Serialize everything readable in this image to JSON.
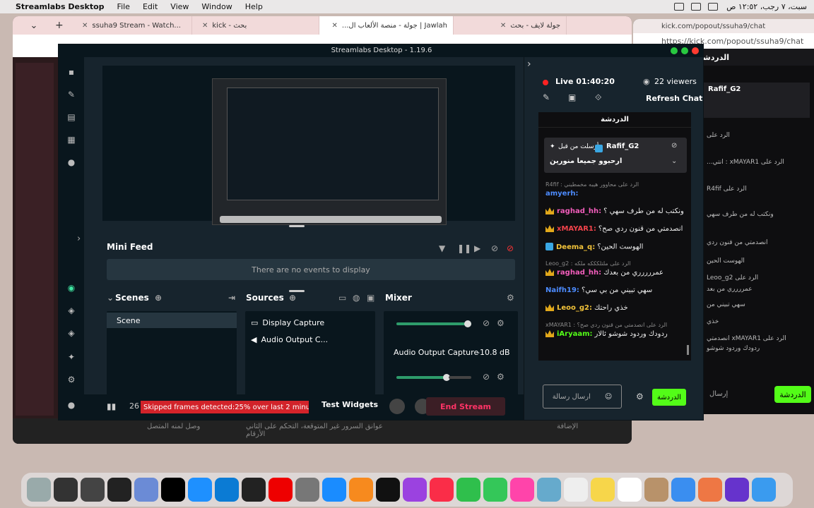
{
  "menubar": {
    "app_name": "Streamlabs Desktop",
    "items": [
      "File",
      "Edit",
      "View",
      "Window",
      "Help"
    ],
    "clock": "سبت، ٧ رجب، ١٢:٥٢ ص"
  },
  "browser": {
    "tabs": [
      {
        "label": "جولة لايف - بحث",
        "active": false
      },
      {
        "label": "Jawlah | جولة - منصة الألعاب ال...",
        "active": true
      },
      {
        "label": "kick - بحث",
        "active": false
      },
      {
        "label": "ssuha9 Stream - Watch...",
        "active": false
      }
    ],
    "bottom_texts": [
      "وصل لمنه المتصل",
      "عوانق السرور غير المتوقعة، التحكم على الثاني الأرقام",
      "الإضافة"
    ]
  },
  "popout": {
    "tab_label": "kick.com/popout/ssuha9/chat",
    "url": "https://kick.com/popout/ssuha9/chat",
    "header": "الدردشة",
    "pinned_user": "Rafif_G2",
    "lines": [
      "الرد على",
      "الرد على xMAYAR1 : انتي...",
      "الرد على R4fif",
      "ونكتب له من طرف سهي",
      "انصدمتي من قنون ردي",
      "الهوست الحين",
      "الرد على Leoo_g2",
      "عمرررري من بعد",
      "سهي تبيني من",
      "خذي",
      "الرد على xMAYAR1 انصدمتي",
      "ردودك وردود شوشو"
    ],
    "send_placeholder": "إرسال",
    "send_button": "الدردشة"
  },
  "streamlabs": {
    "title": "Streamlabs Desktop - 1.19.6",
    "mini_feed": {
      "title": "Mini Feed",
      "empty": "There are no events to display"
    },
    "scenes": {
      "title": "Scenes",
      "items": [
        "Scene"
      ]
    },
    "sources": {
      "title": "Sources",
      "items": [
        "Display Capture",
        "Audio Output C..."
      ]
    },
    "mixer": {
      "title": "Mixer",
      "channel": "Audio Output Capture",
      "db": "-10.8 dB",
      "level_top": 0.98,
      "level_bottom": 0.71
    },
    "footer": {
      "alerts_count": "26",
      "warning": "Skipped frames detected:25% over last 2 minute",
      "test_widgets": "Test Widgets",
      "end_stream": "End Stream"
    },
    "chat": {
      "live": "Live 01:40:20",
      "viewers": "22 viewers",
      "refresh": "Refresh Chat",
      "header": "الدردشة",
      "pinned_label": "أرسلت من قبل",
      "pinned_user": "Rafif_G2",
      "pinned_text": "ارحبوو جميعا منورين",
      "messages": [
        {
          "reply": "R4fif : الرد على محاوور هيبه مخمطيني",
          "badge": "none",
          "user": "amyerh:",
          "text": "",
          "color": "#4d8cff"
        },
        {
          "reply": "",
          "badge": "crown",
          "user": "raghad_hh:",
          "text": "ونكتب له من طرف سهي ؟",
          "color": "#f25dbb"
        },
        {
          "reply": "",
          "badge": "crown",
          "user": "xMAYAR1:",
          "text": "انصدمتي من قنون ردي صح؟",
          "color": "#f2434b"
        },
        {
          "reply": "",
          "badge": "blue",
          "user": "Deema_q:",
          "text": "الهوست الحين؟",
          "color": "#f2c33a"
        },
        {
          "reply": "Leoo_g2 : الرد على ملتلكككه ملكه",
          "badge": "crown",
          "user": "raghad_hh:",
          "text": "عمررررري من بعدك",
          "color": "#f25dbb"
        },
        {
          "reply": "",
          "badge": "none",
          "user": "Naifh19:",
          "text": "سهي تبيني من بي سي؟",
          "color": "#4d8cff"
        },
        {
          "reply": "",
          "badge": "crown",
          "user": "Leoo_g2:",
          "text": "خذي راحتك",
          "color": "#f2c33a"
        },
        {
          "reply": "xMAYAR1 : الرد على انصدمتي من قنون ردي صح؟",
          "badge": "crown",
          "user": "iAryaam:",
          "text": "ردودك وردود شوشو ئالار",
          "color": "#53fc18"
        }
      ],
      "input_placeholder": "ارسال رسالة",
      "send_button": "الدردشة"
    }
  },
  "dock": {
    "apps": [
      {
        "name": "Trash",
        "color": "#9aa"
      },
      {
        "name": "Screenshot1",
        "color": "#333"
      },
      {
        "name": "Screenshot2",
        "color": "#444"
      },
      {
        "name": "Screenshot3",
        "color": "#222"
      },
      {
        "name": "Preview",
        "color": "#6b8bd6"
      },
      {
        "name": "Kick",
        "color": "#000"
      },
      {
        "name": "Safari",
        "color": "#1e90ff"
      },
      {
        "name": "Edge",
        "color": "#0b7bd4"
      },
      {
        "name": "OBS",
        "color": "#222"
      },
      {
        "name": "Opera",
        "color": "#e00"
      },
      {
        "name": "Settings",
        "color": "#777"
      },
      {
        "name": "App Store",
        "color": "#1a8cff"
      },
      {
        "name": "Books",
        "color": "#f78a1e"
      },
      {
        "name": "TV",
        "color": "#111"
      },
      {
        "name": "Podcasts",
        "color": "#9b42e0"
      },
      {
        "name": "Music",
        "color": "#fa2d48"
      },
      {
        "name": "FaceTime",
        "color": "#2fbf4c"
      },
      {
        "name": "Messages",
        "color": "#34c759"
      },
      {
        "name": "Photos",
        "color": "#f4a"
      },
      {
        "name": "Maps",
        "color": "#6ac"
      },
      {
        "name": "Reminders",
        "color": "#eee"
      },
      {
        "name": "Notes",
        "color": "#f7d64a"
      },
      {
        "name": "Calendar",
        "color": "#fff"
      },
      {
        "name": "Contacts",
        "color": "#b8926a"
      },
      {
        "name": "Mail",
        "color": "#3a8ef0"
      },
      {
        "name": "Launchpad",
        "color": "#e74"
      },
      {
        "name": "Siri",
        "color": "#63c"
      },
      {
        "name": "Finder",
        "color": "#3a9bef"
      }
    ]
  }
}
